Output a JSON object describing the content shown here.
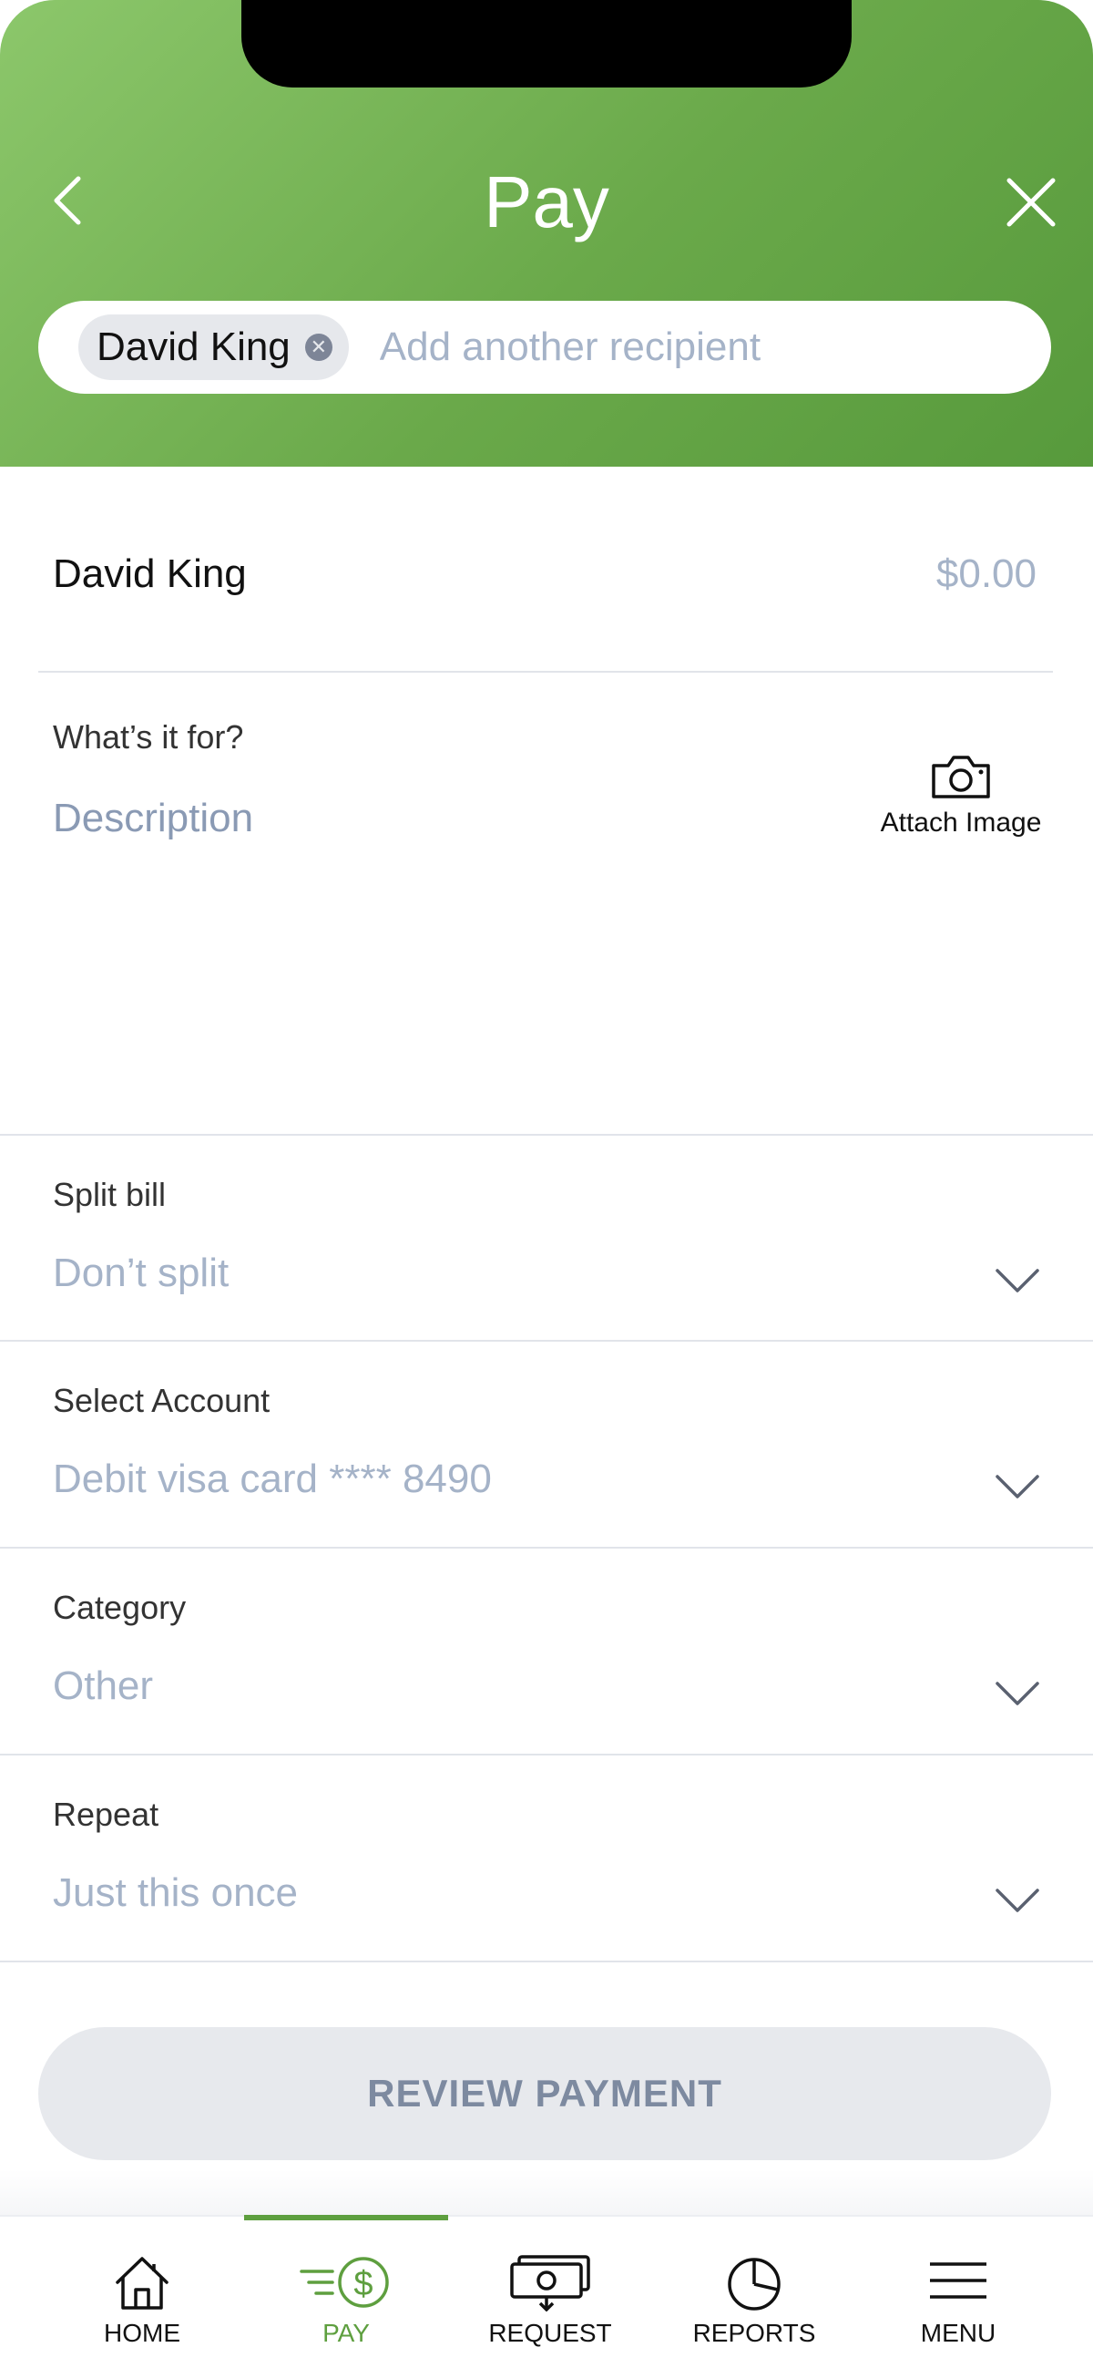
{
  "header": {
    "title": "Pay",
    "recipient_chip": "David King",
    "recipient_placeholder": "Add another recipient"
  },
  "recipient_row": {
    "name": "David King",
    "amount": "$0.00"
  },
  "description": {
    "label": "What’s it for?",
    "placeholder": "Description",
    "attach_label": "Attach Image"
  },
  "split": {
    "label": "Split bill",
    "value": "Don’t split"
  },
  "account": {
    "label": "Select Account",
    "value": "Debit visa card **** 8490"
  },
  "category": {
    "label": "Category",
    "value": "Other"
  },
  "repeat": {
    "label": "Repeat",
    "value": "Just this once"
  },
  "review_button": "REVIEW PAYMENT",
  "tabs": [
    {
      "label": "HOME",
      "icon": "home-icon",
      "active": false
    },
    {
      "label": "PAY",
      "icon": "pay-icon",
      "active": true
    },
    {
      "label": "REQUEST",
      "icon": "request-icon",
      "active": false
    },
    {
      "label": "REPORTS",
      "icon": "reports-icon",
      "active": false
    },
    {
      "label": "MENU",
      "icon": "menu-icon",
      "active": false
    }
  ],
  "colors": {
    "brand_green": "#5e9f3f",
    "header_gradient_start": "#8cc76b",
    "header_gradient_end": "#579a3c",
    "placeholder": "#a5b3c8",
    "button_bg": "#e7e9ed"
  }
}
